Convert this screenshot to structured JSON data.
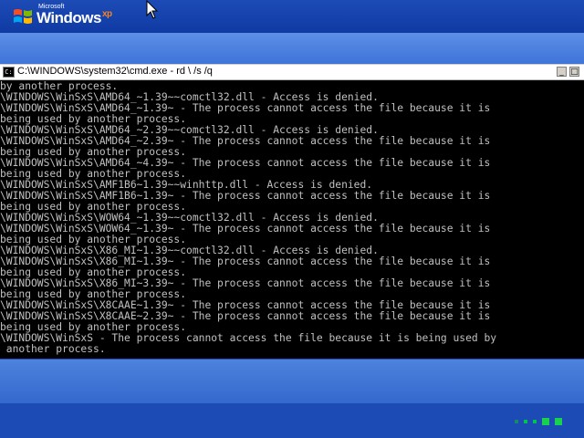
{
  "branding": {
    "microsoft": "Microsoft",
    "windows": "Windows",
    "xp": "xp"
  },
  "console": {
    "title": "C:\\WINDOWS\\system32\\cmd.exe - rd \\ /s /q",
    "min_label": "_",
    "max_label": "□",
    "lines": [
      "by another process.",
      "\\WINDOWS\\WinSxS\\AMD64_~1.39~~comctl32.dll - Access is denied.",
      "\\WINDOWS\\WinSxS\\AMD64_~1.39~ - The process cannot access the file because it is",
      "being used by another process.",
      "\\WINDOWS\\WinSxS\\AMD64_~2.39~~comctl32.dll - Access is denied.",
      "\\WINDOWS\\WinSxS\\AMD64_~2.39~ - The process cannot access the file because it is",
      "being used by another process.",
      "\\WINDOWS\\WinSxS\\AMD64_~4.39~ - The process cannot access the file because it is",
      "being used by another process.",
      "\\WINDOWS\\WinSxS\\AMF1B6~1.39~~winhttp.dll - Access is denied.",
      "\\WINDOWS\\WinSxS\\AMF1B6~1.39~ - The process cannot access the file because it is",
      "being used by another process.",
      "\\WINDOWS\\WinSxS\\WOW64_~1.39~~comctl32.dll - Access is denied.",
      "\\WINDOWS\\WinSxS\\WOW64_~1.39~ - The process cannot access the file because it is",
      "being used by another process.",
      "\\WINDOWS\\WinSxS\\X86_MI~1.39~~comctl32.dll - Access is denied.",
      "\\WINDOWS\\WinSxS\\X86_MI~1.39~ - The process cannot access the file because it is",
      "being used by another process.",
      "\\WINDOWS\\WinSxS\\X86_MI~3.39~ - The process cannot access the file because it is",
      "being used by another process.",
      "\\WINDOWS\\WinSxS\\X8CAAE~1.39~ - The process cannot access the file because it is",
      "\\WINDOWS\\WinSxS\\X8CAAE~2.39~ - The process cannot access the file because it is",
      "being used by another process.",
      "\\WINDOWS\\WinSxS - The process cannot access the file because it is being used by",
      " another process."
    ]
  },
  "icons": {
    "cursor": "mouse-pointer-icon",
    "console": "cmd-icon",
    "flag": "windows-flag-icon"
  },
  "colors": {
    "background": "#1e4fbf",
    "console_text": "#c0c0c0",
    "progress_dot": "#19d04f"
  }
}
